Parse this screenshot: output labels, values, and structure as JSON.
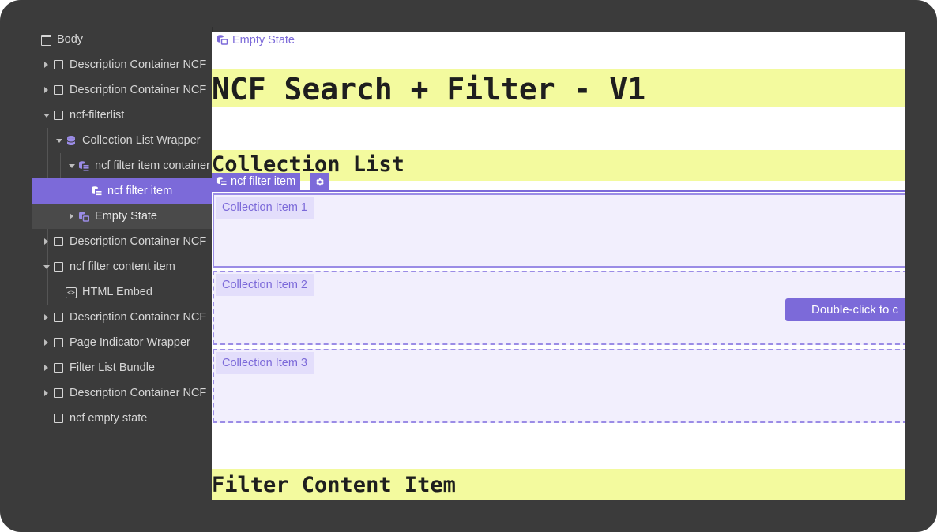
{
  "navigator": {
    "items": [
      {
        "label": "Body"
      },
      {
        "label": "Description Container NCF"
      },
      {
        "label": "Description Container NCF"
      },
      {
        "label": "ncf-filterlist"
      },
      {
        "label": "Collection List Wrapper"
      },
      {
        "label": "ncf filter item container"
      },
      {
        "label": "ncf filter item"
      },
      {
        "label": "Empty State"
      },
      {
        "label": "Description Container NCF"
      },
      {
        "label": "ncf filter content item"
      },
      {
        "label": "HTML Embed"
      },
      {
        "label": "Description Container NCF"
      },
      {
        "label": "Page Indicator Wrapper"
      },
      {
        "label": "Filter List Bundle"
      },
      {
        "label": "Description Container NCF"
      },
      {
        "label": "ncf empty state"
      }
    ]
  },
  "canvas": {
    "empty_state_label": "Empty State",
    "headings": {
      "main": "NCF Search + Filter - V1",
      "collection_list": "Collection List",
      "filter_content": "Filter Content Item"
    },
    "selected_tag": "ncf filter item",
    "collection_items": [
      "Collection Item 1",
      "Collection Item 2",
      "Collection Item 3"
    ],
    "double_click_hint": "Double-click to c"
  },
  "colors": {
    "accent": "#7c6ad9",
    "heading_bg": "#f3fa9e",
    "panel_bg": "#3b3b3b",
    "item_bg": "#f2effd"
  }
}
